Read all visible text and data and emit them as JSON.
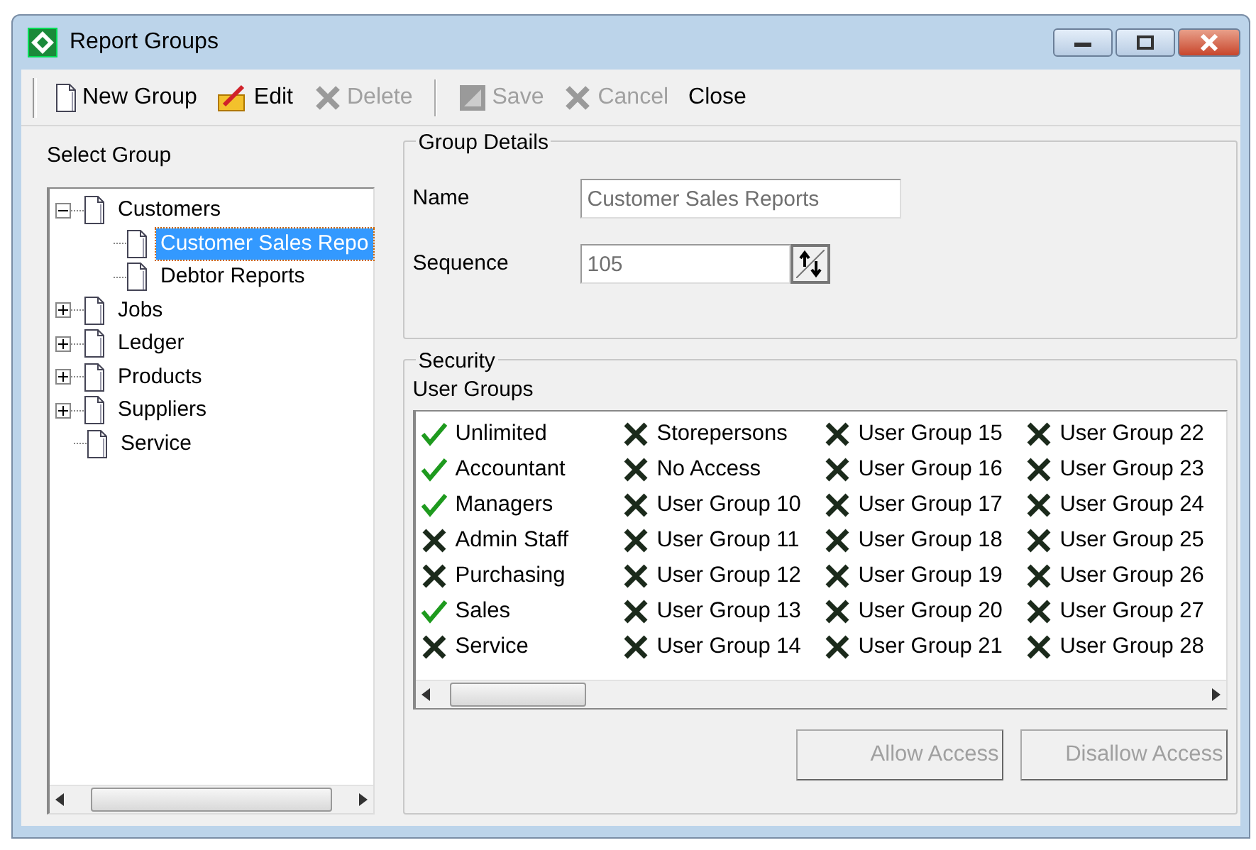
{
  "window": {
    "title": "Report Groups"
  },
  "toolbar": [
    {
      "kind": "new",
      "label": "New Group",
      "disabled": false
    },
    {
      "kind": "edit",
      "label": "Edit",
      "disabled": false
    },
    {
      "kind": "delete",
      "label": "Delete",
      "disabled": true
    },
    {
      "kind": "save",
      "label": "Save",
      "disabled": true
    },
    {
      "kind": "cancel",
      "label": "Cancel",
      "disabled": true
    },
    {
      "kind": "close",
      "label": "Close",
      "disabled": false
    }
  ],
  "select_group": {
    "label": "Select Group",
    "tree": [
      {
        "label": "Customers",
        "expanded": true,
        "selected": false,
        "children": [
          {
            "label": "Customer Sales Repo",
            "selected": true
          },
          {
            "label": "Debtor Reports",
            "selected": false
          }
        ]
      },
      {
        "label": "Jobs",
        "expanded": false,
        "selected": false
      },
      {
        "label": "Ledger",
        "expanded": false,
        "selected": false
      },
      {
        "label": "Products",
        "expanded": false,
        "selected": false
      },
      {
        "label": "Suppliers",
        "expanded": false,
        "selected": false
      },
      {
        "label": "Service",
        "selected": false
      }
    ]
  },
  "group_details": {
    "title": "Group Details",
    "name_label": "Name",
    "name_value": "Customer Sales Reports",
    "sequence_label": "Sequence",
    "sequence_value": "105",
    "disabled": true
  },
  "security": {
    "title": "Security",
    "user_groups_label": "User Groups",
    "user_groups": [
      {
        "label": "Unlimited",
        "allowed": true
      },
      {
        "label": "Accountant",
        "allowed": true
      },
      {
        "label": "Managers",
        "allowed": true
      },
      {
        "label": "Admin Staff",
        "allowed": false
      },
      {
        "label": "Purchasing",
        "allowed": false
      },
      {
        "label": "Sales",
        "allowed": true
      },
      {
        "label": "Service",
        "allowed": false
      },
      {
        "label": "Storepersons",
        "allowed": false
      },
      {
        "label": "No Access",
        "allowed": false
      },
      {
        "label": "User Group 10",
        "allowed": false
      },
      {
        "label": "User Group 11",
        "allowed": false
      },
      {
        "label": "User Group 12",
        "allowed": false
      },
      {
        "label": "User Group 13",
        "allowed": false
      },
      {
        "label": "User Group 14",
        "allowed": false
      },
      {
        "label": "User Group 15",
        "allowed": false
      },
      {
        "label": "User Group 16",
        "allowed": false
      },
      {
        "label": "User Group 17",
        "allowed": false
      },
      {
        "label": "User Group 18",
        "allowed": false
      },
      {
        "label": "User Group 19",
        "allowed": false
      },
      {
        "label": "User Group 20",
        "allowed": false
      },
      {
        "label": "User Group 21",
        "allowed": false
      },
      {
        "label": "User Group 22",
        "allowed": false
      },
      {
        "label": "User Group 23",
        "allowed": false
      },
      {
        "label": "User Group 24",
        "allowed": false
      },
      {
        "label": "User Group 25",
        "allowed": false
      },
      {
        "label": "User Group 26",
        "allowed": false
      },
      {
        "label": "User Group 27",
        "allowed": false
      },
      {
        "label": "User Group 28",
        "allowed": false
      }
    ],
    "buttons": [
      {
        "label": "Allow Access",
        "disabled": true
      },
      {
        "label": "Disallow Access",
        "disabled": true
      }
    ]
  }
}
